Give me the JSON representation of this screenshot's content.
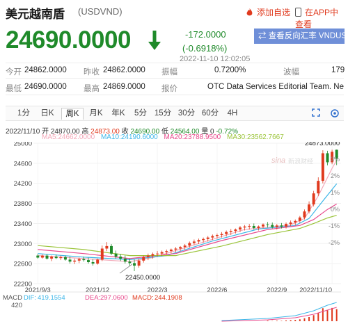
{
  "header": {
    "pair_name": "美元越南盾",
    "pair_code": "(USDVND)",
    "add_favorite": "添加自选",
    "open_in_app": "在APP中查看"
  },
  "quote": {
    "price": "24690.0000",
    "change": "-172.0000",
    "change_pct": "(-0.6918%)",
    "timestamp": "2022-11-10 12:02:05",
    "reverse_button": "查看反向汇率 VNDUSD"
  },
  "stats": {
    "open_label": "今开",
    "open": "24862.0000",
    "prev_close_label": "昨收",
    "prev_close": "24862.0000",
    "amplitude_label": "振幅",
    "amplitude": "0.7200%",
    "wave_label": "波幅",
    "wave": "179",
    "low_label": "最低",
    "low": "24690.0000",
    "high_label": "最高",
    "high": "24869.0000",
    "quote_label": "报价",
    "quote_source": "OTC Data Services Editorial Team. New..."
  },
  "tabs": [
    "1分",
    "日K",
    "周K",
    "月K",
    "年K",
    "5分",
    "15分",
    "30分",
    "60分",
    "4H"
  ],
  "active_tab": "周K",
  "candle_info": {
    "date": "2022/11/10",
    "open_label": "开",
    "open": "24870.00",
    "high_label": "高",
    "high": "24873.00",
    "close_label": "收",
    "close": "24690.00",
    "low_label": "低",
    "low": "24564.00",
    "volume_label": "量",
    "volume": "0",
    "change_pct": "-0.72%"
  },
  "moving_averages": [
    {
      "label": "MA5:",
      "value": "24662.0000",
      "color": "#f3a8b8"
    },
    {
      "label": "MA10:",
      "value": "24190.6000",
      "color": "#3cb6e8"
    },
    {
      "label": "MA20:",
      "value": "23788.9500",
      "color": "#e8498c"
    },
    {
      "label": "MA30:",
      "value": "23562.7667",
      "color": "#9bc43a"
    }
  ],
  "macd": {
    "label": "MACD",
    "dif_label": "DIF:",
    "dif": "419.1554",
    "dea_label": "DEA:",
    "dea": "297.0600",
    "macd_label": "MACD:",
    "macd": "244.1908",
    "tick": "420"
  },
  "colors": {
    "up": "#e03a1e",
    "down": "#1f8a2a",
    "accent": "#6f8fd8"
  },
  "chart_data": {
    "type": "candlestick",
    "title": "",
    "y_ticks": [
      "25000",
      "24600",
      "24200",
      "23800",
      "23400",
      "23000",
      "22600",
      "22200"
    ],
    "ylim": [
      22200,
      25000
    ],
    "pct_ticks": [
      "3%",
      "2%",
      "1%",
      "0%",
      "-1%",
      "-2%"
    ],
    "x_ticks": [
      "2021/9/3",
      "2021/12",
      "2022/3",
      "2022/6",
      "2022/9",
      "2022/11/10"
    ],
    "annotations": {
      "max": "24873.0000",
      "min": "22450.0000"
    },
    "candles": [
      {
        "o": 22760,
        "h": 22790,
        "l": 22700,
        "c": 22720
      },
      {
        "o": 22720,
        "h": 22780,
        "l": 22700,
        "c": 22760
      },
      {
        "o": 22760,
        "h": 22790,
        "l": 22680,
        "c": 22700
      },
      {
        "o": 22700,
        "h": 22760,
        "l": 22650,
        "c": 22740
      },
      {
        "o": 22740,
        "h": 22780,
        "l": 22690,
        "c": 22710
      },
      {
        "o": 22710,
        "h": 22760,
        "l": 22670,
        "c": 22730
      },
      {
        "o": 22730,
        "h": 22760,
        "l": 22660,
        "c": 22680
      },
      {
        "o": 22680,
        "h": 22740,
        "l": 22600,
        "c": 22640
      },
      {
        "o": 22640,
        "h": 22700,
        "l": 22590,
        "c": 22660
      },
      {
        "o": 22660,
        "h": 22720,
        "l": 22610,
        "c": 22690
      },
      {
        "o": 22690,
        "h": 22740,
        "l": 22640,
        "c": 22670
      },
      {
        "o": 22670,
        "h": 22720,
        "l": 22600,
        "c": 22630
      },
      {
        "o": 22630,
        "h": 22690,
        "l": 22560,
        "c": 22600
      },
      {
        "o": 22600,
        "h": 22700,
        "l": 22580,
        "c": 22680
      },
      {
        "o": 22680,
        "h": 22960,
        "l": 22650,
        "c": 22900
      },
      {
        "o": 22900,
        "h": 23030,
        "l": 22850,
        "c": 22950
      },
      {
        "o": 22950,
        "h": 22990,
        "l": 22770,
        "c": 22800
      },
      {
        "o": 22800,
        "h": 22860,
        "l": 22700,
        "c": 22740
      },
      {
        "o": 22740,
        "h": 22790,
        "l": 22650,
        "c": 22700
      },
      {
        "o": 22700,
        "h": 22760,
        "l": 22600,
        "c": 22640
      },
      {
        "o": 22640,
        "h": 22700,
        "l": 22560,
        "c": 22610
      },
      {
        "o": 22610,
        "h": 22680,
        "l": 22450,
        "c": 22560
      },
      {
        "o": 22560,
        "h": 22700,
        "l": 22520,
        "c": 22660
      },
      {
        "o": 22660,
        "h": 22760,
        "l": 22620,
        "c": 22730
      },
      {
        "o": 22730,
        "h": 22800,
        "l": 22670,
        "c": 22760
      },
      {
        "o": 22760,
        "h": 22820,
        "l": 22700,
        "c": 22790
      },
      {
        "o": 22790,
        "h": 22850,
        "l": 22740,
        "c": 22800
      },
      {
        "o": 22800,
        "h": 22860,
        "l": 22750,
        "c": 22830
      },
      {
        "o": 22830,
        "h": 22880,
        "l": 22780,
        "c": 22850
      },
      {
        "o": 22850,
        "h": 22900,
        "l": 22800,
        "c": 22880
      },
      {
        "o": 22880,
        "h": 22930,
        "l": 22830,
        "c": 22900
      },
      {
        "o": 22900,
        "h": 22950,
        "l": 22850,
        "c": 22930
      },
      {
        "o": 22930,
        "h": 22990,
        "l": 22880,
        "c": 22960
      },
      {
        "o": 22960,
        "h": 23040,
        "l": 22920,
        "c": 23010
      },
      {
        "o": 23010,
        "h": 23080,
        "l": 22970,
        "c": 23040
      },
      {
        "o": 23040,
        "h": 23100,
        "l": 22990,
        "c": 23070
      },
      {
        "o": 23070,
        "h": 23120,
        "l": 23020,
        "c": 23090
      },
      {
        "o": 23090,
        "h": 23150,
        "l": 23040,
        "c": 23120
      },
      {
        "o": 23120,
        "h": 23180,
        "l": 23070,
        "c": 23150
      },
      {
        "o": 23150,
        "h": 23200,
        "l": 23100,
        "c": 23170
      },
      {
        "o": 23170,
        "h": 23230,
        "l": 23120,
        "c": 23190
      },
      {
        "o": 23190,
        "h": 23260,
        "l": 23140,
        "c": 23230
      },
      {
        "o": 23230,
        "h": 23290,
        "l": 23170,
        "c": 23250
      },
      {
        "o": 23250,
        "h": 23300,
        "l": 23200,
        "c": 23280
      },
      {
        "o": 23280,
        "h": 23350,
        "l": 23230,
        "c": 23320
      },
      {
        "o": 23320,
        "h": 23370,
        "l": 23260,
        "c": 23340
      },
      {
        "o": 23340,
        "h": 23390,
        "l": 23280,
        "c": 23350
      },
      {
        "o": 23350,
        "h": 23400,
        "l": 23280,
        "c": 23310
      },
      {
        "o": 23310,
        "h": 23360,
        "l": 23260,
        "c": 23340
      },
      {
        "o": 23340,
        "h": 23400,
        "l": 23300,
        "c": 23380
      },
      {
        "o": 23380,
        "h": 23430,
        "l": 23320,
        "c": 23370
      },
      {
        "o": 23370,
        "h": 23420,
        "l": 23300,
        "c": 23330
      },
      {
        "o": 23330,
        "h": 23390,
        "l": 23280,
        "c": 23360
      },
      {
        "o": 23360,
        "h": 23410,
        "l": 23300,
        "c": 23340
      },
      {
        "o": 23340,
        "h": 23420,
        "l": 23300,
        "c": 23390
      },
      {
        "o": 23390,
        "h": 23460,
        "l": 23350,
        "c": 23420
      },
      {
        "o": 23420,
        "h": 23480,
        "l": 23370,
        "c": 23450
      },
      {
        "o": 23450,
        "h": 23550,
        "l": 23410,
        "c": 23520
      },
      {
        "o": 23520,
        "h": 23680,
        "l": 23480,
        "c": 23640
      },
      {
        "o": 23640,
        "h": 23840,
        "l": 23600,
        "c": 23780
      },
      {
        "o": 23780,
        "h": 24050,
        "l": 23740,
        "c": 24000
      },
      {
        "o": 24000,
        "h": 24320,
        "l": 23950,
        "c": 24250
      },
      {
        "o": 24250,
        "h": 24860,
        "l": 24200,
        "c": 24800
      },
      {
        "o": 24800,
        "h": 24850,
        "l": 24560,
        "c": 24620
      },
      {
        "o": 24620,
        "h": 24870,
        "l": 24580,
        "c": 24830
      },
      {
        "o": 24870,
        "h": 24873,
        "l": 24564,
        "c": 24690
      }
    ],
    "ma_series": [
      {
        "name": "MA5",
        "values": [
          [
            0,
            22760
          ],
          [
            10,
            22700
          ],
          [
            20,
            22640
          ],
          [
            25,
            22720
          ],
          [
            35,
            23000
          ],
          [
            45,
            23280
          ],
          [
            55,
            23370
          ],
          [
            58,
            23500
          ],
          [
            61,
            23950
          ],
          [
            64,
            24500
          ],
          [
            65,
            24662
          ]
        ]
      },
      {
        "name": "MA10",
        "values": [
          [
            0,
            22800
          ],
          [
            10,
            22730
          ],
          [
            20,
            22680
          ],
          [
            28,
            22760
          ],
          [
            38,
            23050
          ],
          [
            48,
            23290
          ],
          [
            56,
            23360
          ],
          [
            59,
            23500
          ],
          [
            62,
            23850
          ],
          [
            65,
            24190
          ]
        ]
      },
      {
        "name": "MA20",
        "values": [
          [
            0,
            22880
          ],
          [
            10,
            22800
          ],
          [
            20,
            22700
          ],
          [
            30,
            22800
          ],
          [
            40,
            23060
          ],
          [
            50,
            23280
          ],
          [
            57,
            23360
          ],
          [
            60,
            23480
          ],
          [
            63,
            23680
          ],
          [
            65,
            23789
          ]
        ]
      },
      {
        "name": "MA30",
        "values": [
          [
            0,
            22960
          ],
          [
            10,
            22880
          ],
          [
            20,
            22760
          ],
          [
            30,
            22760
          ],
          [
            40,
            22950
          ],
          [
            50,
            23180
          ],
          [
            57,
            23300
          ],
          [
            60,
            23400
          ],
          [
            63,
            23510
          ],
          [
            65,
            23563
          ]
        ]
      }
    ]
  }
}
